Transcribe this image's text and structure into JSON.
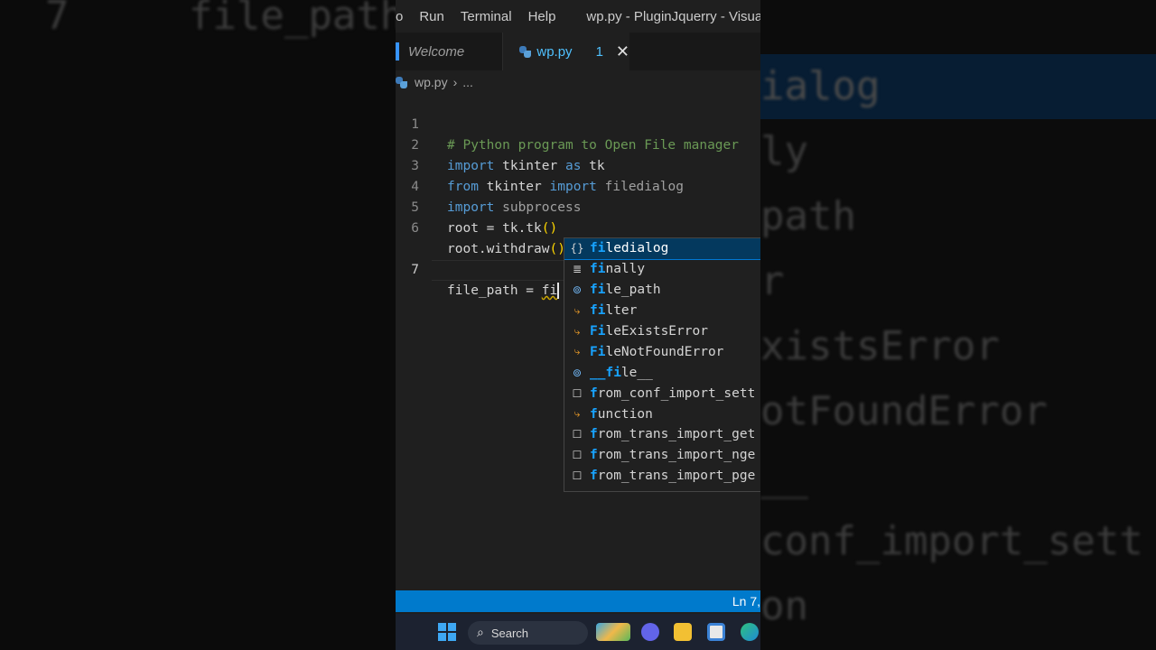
{
  "background": {
    "left_lines": [
      "7     file_path"
    ],
    "right_lines": [
      "ialog",
      "ly",
      "path",
      "r",
      "xistsError",
      "otFoundError",
      "__",
      "conf_import_sett",
      "on"
    ]
  },
  "menubar": {
    "items": [
      "o",
      "Run",
      "Terminal",
      "Help"
    ],
    "title": "wp.py - PluginJquerry - Visual"
  },
  "tabs": [
    {
      "label": "Welcome"
    },
    {
      "label": "wp.py",
      "badge": "1"
    }
  ],
  "breadcrumb": {
    "file": "wp.py",
    "more": "..."
  },
  "editor": {
    "line_numbers": [
      "1",
      "2",
      "3",
      "4",
      "5",
      "6",
      "7"
    ]
  },
  "suggestions": [
    {
      "icon": "{}",
      "prefix": "fi",
      "rest": "ledialog"
    },
    {
      "icon": "≣",
      "prefix": "fi",
      "rest": "nally"
    },
    {
      "icon": "⊚",
      "prefix": "fi",
      "rest": "le_path"
    },
    {
      "icon": "⤷",
      "prefix": "fi",
      "rest": "lter"
    },
    {
      "icon": "⤷",
      "prefix": "Fi",
      "rest": "leExistsError"
    },
    {
      "icon": "⤷",
      "prefix": "Fi",
      "rest": "leNotFoundError"
    },
    {
      "icon": "⊚",
      "prefix": "__fi",
      "rest": "le__"
    },
    {
      "icon": "☐",
      "prefix": "f",
      "rest": "rom_conf_import_sett"
    },
    {
      "icon": "⤷",
      "prefix": "f",
      "rest": "unction"
    },
    {
      "icon": "☐",
      "prefix": "f",
      "rest": "rom_trans_import_get"
    },
    {
      "icon": "☐",
      "prefix": "f",
      "rest": "rom_trans_import_nge"
    },
    {
      "icon": "☐",
      "prefix": "f",
      "rest": "rom_trans_import_pge"
    }
  ],
  "statusbar": {
    "position": "Ln 7,"
  },
  "taskbar": {
    "search_label": "Search"
  },
  "colors": {
    "accent": "#007acc",
    "selection": "#04395e",
    "highlight": "#18a3ff"
  }
}
